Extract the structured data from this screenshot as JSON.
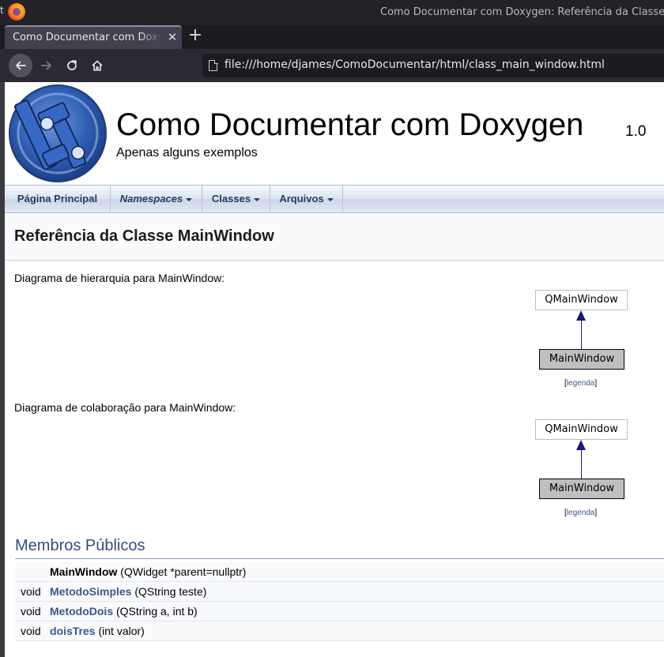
{
  "browser": {
    "window_title": "Como Documentar com Doxygen: Referência da Classe Mai",
    "edge_chars": [
      "t",
      "e"
    ],
    "tab_label": "Como Documentar com Doxyg",
    "tab_close": "✕",
    "new_tab": "+",
    "url": "file:///home/djames/ComoDocumentar/html/class_main_window.html"
  },
  "project": {
    "name": "Como Documentar com Doxygen",
    "number": "1.0",
    "brief": "Apenas alguns exemplos"
  },
  "menu": [
    {
      "label": "Página Principal",
      "dropdown": false,
      "italic": false
    },
    {
      "label": "Namespaces",
      "dropdown": true,
      "italic": true
    },
    {
      "label": "Classes",
      "dropdown": true,
      "italic": false
    },
    {
      "label": "Arquivos",
      "dropdown": true,
      "italic": false
    }
  ],
  "page_title": "Referência da Classe MainWindow",
  "inheritance": {
    "caption": "Diagrama de hierarquia para MainWindow:",
    "base": "QMainWindow",
    "derived": "MainWindow",
    "legend": "legenda"
  },
  "collaboration": {
    "caption": "Diagrama de colaboração para MainWindow:",
    "base": "QMainWindow",
    "derived": "MainWindow",
    "legend": "legenda"
  },
  "public_members": {
    "heading": "Membros Públicos",
    "rows": [
      {
        "type": "",
        "name": "MainWindow",
        "args": " (QWidget *parent=nullptr)"
      },
      {
        "type": "void",
        "name": "MetodoSimples",
        "args": " (QString teste)"
      },
      {
        "type": "void",
        "name": "MetodoDois",
        "args": " (QString a, int b)"
      },
      {
        "type": "void",
        "name": "doisTres",
        "args": " (int valor)"
      }
    ]
  },
  "colors": {
    "link": "#3d578c",
    "arrow": "#191970",
    "group_header": "#354c7b"
  }
}
